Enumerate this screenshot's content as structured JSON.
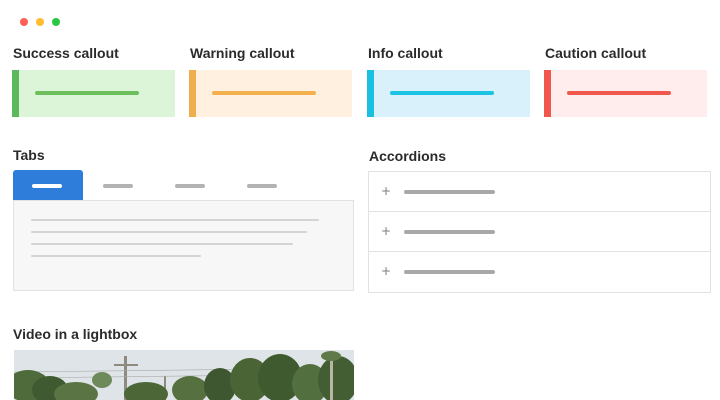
{
  "window_controls": [
    {
      "name": "close",
      "color": "#fe5f57"
    },
    {
      "name": "minimize",
      "color": "#febc2e"
    },
    {
      "name": "maximize",
      "color": "#28c840"
    }
  ],
  "callouts": [
    {
      "title": "Success callout",
      "background": "#dcf5d8",
      "accent": "#5cb85c",
      "line": "#6cbf5c"
    },
    {
      "title": "Warning callout",
      "background": "#fff0df",
      "accent": "#f0ad4e",
      "line": "#f2b04e"
    },
    {
      "title": "Info callout",
      "background": "#d8f1fb",
      "accent": "#1ac0e0",
      "line": "#1cc3e3"
    },
    {
      "title": "Caution callout",
      "background": "#ffecec",
      "accent": "#f0574d",
      "line": "#f0574d"
    }
  ],
  "tabs": {
    "title": "Tabs",
    "active_color": "#2f7ddb",
    "tab_count": 4,
    "active_index": 0
  },
  "accordions": {
    "title": "Accordions",
    "items": [
      {
        "icon": "+"
      },
      {
        "icon": "+"
      },
      {
        "icon": "+"
      }
    ]
  },
  "video": {
    "title": "Video in a lightbox"
  }
}
